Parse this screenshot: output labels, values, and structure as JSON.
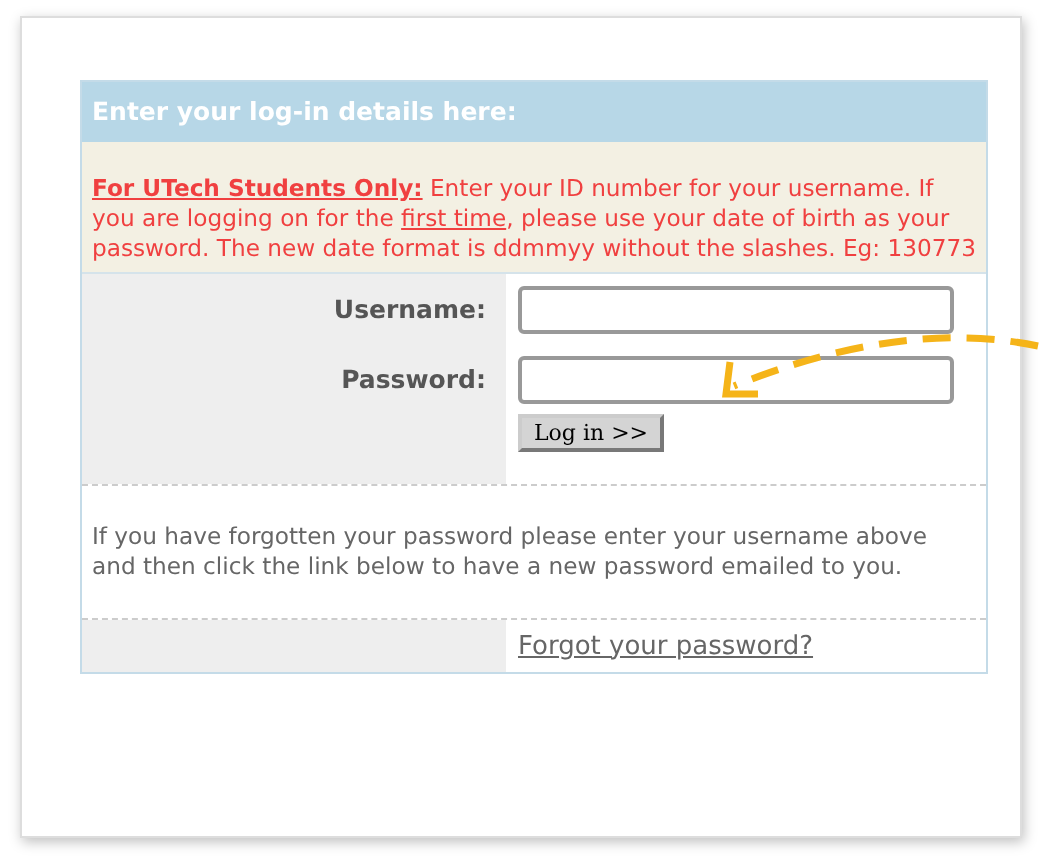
{
  "header": {
    "title": "Enter your log-in details here:"
  },
  "notice": {
    "lead": "For UTech Students Only:",
    "text": " Enter your ID number for your username. If you are logging on for the ",
    "link": "first time",
    "text_end": ", please use your date of birth as your password. The new date format is ddmmyy without the slashes. Eg: 130773"
  },
  "fields": [
    {
      "label": "Username:"
    },
    {
      "label": "Password:"
    }
  ],
  "submit": {
    "label": "Log in >>"
  },
  "help": {
    "text": "If you have forgotten your password please enter your username above and then click the link below to have a new password emailed to you."
  },
  "forgot_link": {
    "label": "Forgot your password?"
  }
}
